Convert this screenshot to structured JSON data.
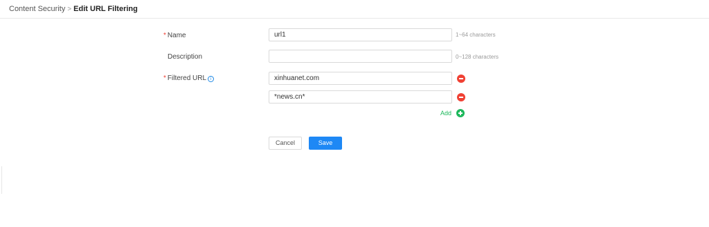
{
  "breadcrumb": {
    "parent": "Content Security",
    "separator": ">",
    "current": "Edit URL Filtering"
  },
  "form": {
    "name": {
      "label": "Name",
      "required_mark": "*",
      "value": "url1",
      "hint": "1~64 characters"
    },
    "description": {
      "label": "Description",
      "value": "",
      "hint": "0~128 characters"
    },
    "filtered_url": {
      "label": "Filtered URL",
      "required_mark": "*",
      "info_icon": "i",
      "entries": [
        "xinhuanet.com",
        "*news.cn*"
      ],
      "add_label": "Add"
    }
  },
  "actions": {
    "cancel_label": "Cancel",
    "save_label": "Save"
  },
  "icons": {
    "info": "info-circle-icon",
    "remove": "minus-circle-icon",
    "add": "plus-circle-icon"
  },
  "colors": {
    "primary": "#1e88f5",
    "danger": "#f04134",
    "success": "#1eb85c",
    "required": "#f04134"
  }
}
